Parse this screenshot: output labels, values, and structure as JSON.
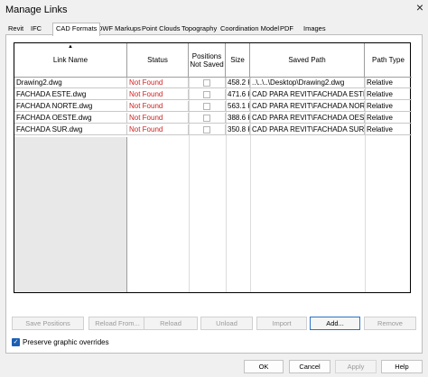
{
  "window": {
    "title": "Manage Links",
    "close_glyph": "×"
  },
  "tabs": [
    {
      "label": "Revit"
    },
    {
      "label": "IFC"
    },
    {
      "label": "CAD Formats",
      "active": true
    },
    {
      "label": "DWF Markups"
    },
    {
      "label": "Point Clouds"
    },
    {
      "label": "Topography"
    },
    {
      "label": "Coordination Model"
    },
    {
      "label": "PDF"
    },
    {
      "label": "Images"
    }
  ],
  "table": {
    "columns": [
      "Link Name",
      "Status",
      "Positions Not Saved",
      "Size",
      "Saved Path",
      "Path Type"
    ],
    "sort_caret": "▲",
    "rows": [
      {
        "name": "Drawing2.dwg",
        "status": "Not Found",
        "size": "458.2 K",
        "path": "..\\..\\..\\Desktop\\Drawing2.dwg",
        "path_type": "Relative"
      },
      {
        "name": "FACHADA ESTE.dwg",
        "status": "Not Found",
        "size": "471.6 K",
        "path": "CAD PARA REVIT\\FACHADA ESTE.",
        "path_type": "Relative"
      },
      {
        "name": "FACHADA NORTE.dwg",
        "status": "Not Found",
        "size": "563.1 K",
        "path": "CAD PARA REVIT\\FACHADA NOR",
        "path_type": "Relative"
      },
      {
        "name": "FACHADA OESTE.dwg",
        "status": "Not Found",
        "size": "388.6 K",
        "path": "CAD PARA REVIT\\FACHADA OEST",
        "path_type": "Relative"
      },
      {
        "name": "FACHADA SUR.dwg",
        "status": "Not Found",
        "size": "350.8 K",
        "path": "CAD PARA REVIT\\FACHADA SUR.",
        "path_type": "Relative"
      }
    ]
  },
  "actions": {
    "save_positions": "Save Positions",
    "reload_from": "Reload From...",
    "reload": "Reload",
    "unload": "Unload",
    "import": "Import",
    "add": "Add...",
    "remove": "Remove"
  },
  "preserve": {
    "label": "Preserve graphic overrides",
    "checked": true,
    "check_glyph": "✓"
  },
  "dialog_buttons": {
    "ok": "OK",
    "cancel": "Cancel",
    "apply": "Apply",
    "help": "Help"
  },
  "colors": {
    "not_found": "#d21f1f",
    "accent": "#1a5fb4"
  }
}
